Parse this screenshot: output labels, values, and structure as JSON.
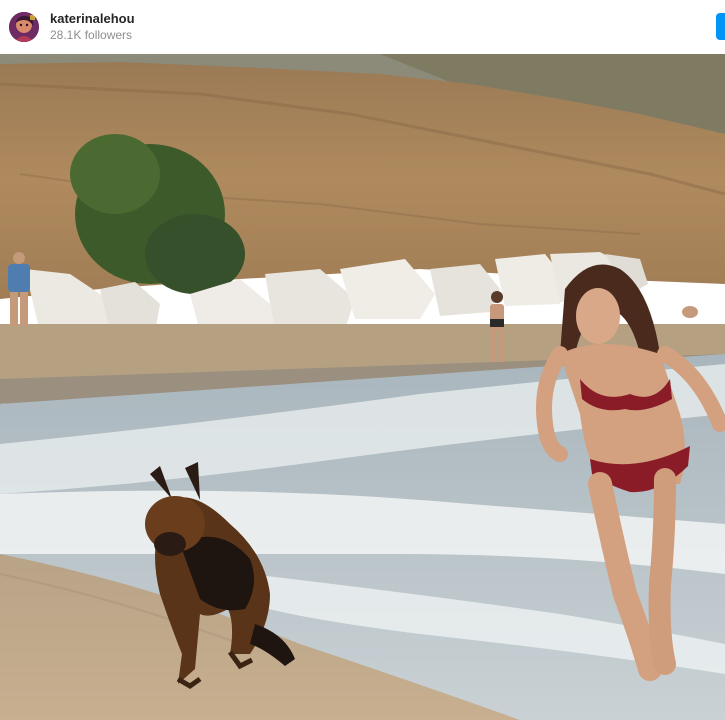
{
  "header": {
    "username": "katerinalehou",
    "followers": "28.1K followers",
    "avatar_icon": "profile-avatar",
    "follow_button_color": "#0095f6"
  },
  "photo": {
    "alt_icon": "beach-photo"
  },
  "colors": {
    "username": "#262626",
    "secondary_text": "#8e8e8e",
    "accent": "#0095f6"
  }
}
